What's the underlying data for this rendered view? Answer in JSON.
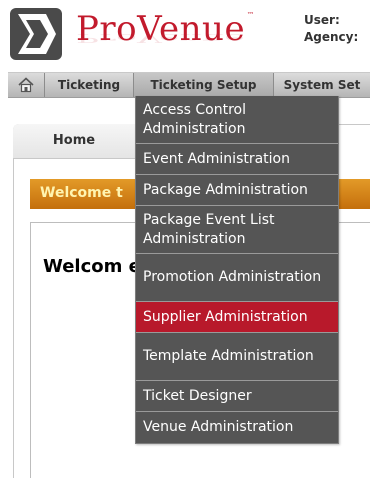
{
  "header": {
    "brand": "ProVenue",
    "trademark": "™",
    "user_label": "User:",
    "agency_label": "Agency:"
  },
  "nav": {
    "home_icon": "home-icon",
    "items": [
      "Ticketing",
      "Ticketing Setup",
      "System Set"
    ]
  },
  "tabs": {
    "home": "Home"
  },
  "welcome": {
    "bar_text": "Welcome t",
    "heading": "Welcom                     e T"
  },
  "dropdown": {
    "items": [
      "Access Control Administration",
      "Event Administration",
      "Package Administration",
      "Package Event List Administration",
      "Promotion Administration",
      "Supplier Administration",
      "Template Administration",
      "Ticket Designer",
      "Venue Administration"
    ],
    "highlighted": "Supplier Administration",
    "highlight_color": "#b8192b",
    "background_color": "#555555"
  },
  "colors": {
    "brand_red": "#c21a2c",
    "welcome_bar": "#d8831a"
  }
}
